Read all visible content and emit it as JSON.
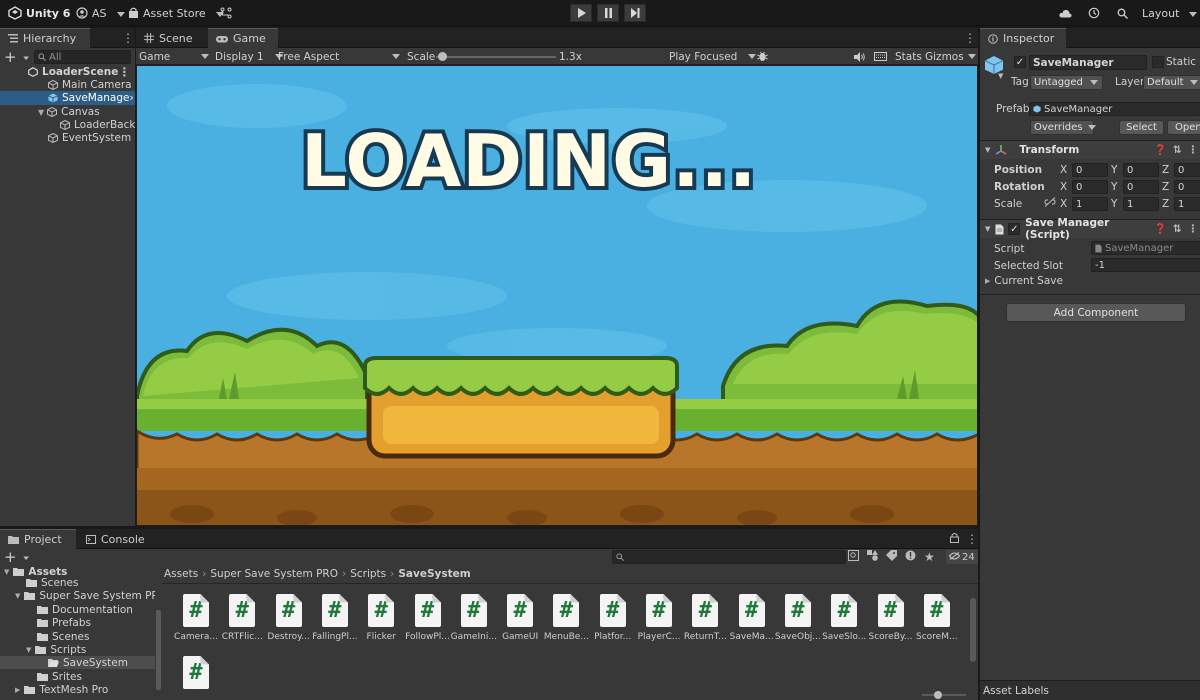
{
  "topbar": {
    "app_title": "Unity 6",
    "account": "AS",
    "asset_store": "Asset Store",
    "layout": "Layout"
  },
  "hierarchy": {
    "tab_label": "Hierarchy",
    "search_placeholder": "All",
    "items": [
      {
        "label": "LoaderScene"
      },
      {
        "label": "Main Camera"
      },
      {
        "label": "SaveManage"
      },
      {
        "label": "Canvas"
      },
      {
        "label": "LoaderBackgr"
      },
      {
        "label": "EventSystem"
      }
    ]
  },
  "scene_tabs": {
    "scene": "Scene",
    "game": "Game"
  },
  "game_toolbar": {
    "game_select": "Game",
    "display": "Display 1",
    "aspect": "Free Aspect",
    "scale_label": "Scale",
    "scale_value": "1.3x",
    "scale_fraction": 0.05,
    "play_mode": "Play Focused",
    "stats": "Stats",
    "gizmos": "Gizmos"
  },
  "game_view": {
    "loading_text": "LOADING...",
    "sky_color": "#4ab0e2",
    "grass_color": "#7cbc3a",
    "dirt_color": "#b8762a"
  },
  "inspector": {
    "tab_label": "Inspector",
    "object_name": "SaveManager",
    "static_label": "Static",
    "tag_label": "Tag",
    "tag_value": "Untagged",
    "layer_label": "Layer",
    "layer_value": "Default",
    "prefab_label": "Prefab",
    "prefab_value": "SaveManager",
    "overrides": "Overrides",
    "select": "Select",
    "open": "Open",
    "transform": {
      "title": "Transform",
      "position_label": "Position",
      "rotation_label": "Rotation",
      "scale_label": "Scale",
      "position": [
        "0",
        "0",
        "0"
      ],
      "rotation": [
        "0",
        "0",
        "0"
      ],
      "scale": [
        "1",
        "1",
        "1"
      ]
    },
    "script_component": {
      "title": "Save Manager (Script)",
      "script_label": "Script",
      "script_value": "SaveManager",
      "selected_slot_label": "Selected Slot",
      "selected_slot_value": "-1",
      "current_save_label": "Current Save"
    },
    "add_component": "Add Component",
    "asset_labels": "Asset Labels"
  },
  "project": {
    "tab_label": "Project",
    "console_label": "Console",
    "hidden_count": "24",
    "tree": [
      {
        "label": "Assets"
      },
      {
        "label": "Scenes"
      },
      {
        "label": "Super Save System PRO"
      },
      {
        "label": "Documentation"
      },
      {
        "label": "Prefabs"
      },
      {
        "label": "Scenes"
      },
      {
        "label": "Scripts"
      },
      {
        "label": "SaveSystem"
      },
      {
        "label": "Srites"
      },
      {
        "label": "TextMesh Pro"
      }
    ],
    "breadcrumb": [
      "Assets",
      "Super Save System PRO",
      "Scripts",
      "SaveSystem"
    ],
    "assets": [
      {
        "label": "Camera..."
      },
      {
        "label": "CRTFlic..."
      },
      {
        "label": "Destroy..."
      },
      {
        "label": "FallingPl..."
      },
      {
        "label": "Flicker"
      },
      {
        "label": "FollowPl..."
      },
      {
        "label": "GameIni..."
      },
      {
        "label": "GameUI"
      },
      {
        "label": "MenuBe..."
      },
      {
        "label": "Platfor..."
      },
      {
        "label": "PlayerC..."
      },
      {
        "label": "ReturnT..."
      },
      {
        "label": "SaveMa..."
      },
      {
        "label": "SaveObj..."
      },
      {
        "label": "SaveSlo..."
      },
      {
        "label": "ScoreBy..."
      },
      {
        "label": "ScoreM..."
      },
      {
        "label": ""
      }
    ]
  }
}
